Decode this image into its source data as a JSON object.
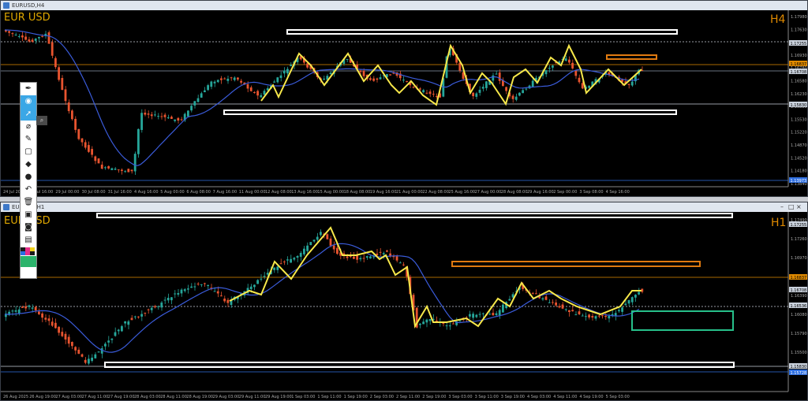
{
  "top": {
    "title": "EURUSD,H4",
    "symbol": "EUR USD",
    "timeframe": "H4",
    "price_labels": [
      "1.17980",
      "1.17630",
      "1.17280",
      "1.16930",
      "1.16780",
      "1.16580",
      "1.16230",
      "1.15880",
      "1.15530",
      "1.15220",
      "1.14870",
      "1.14520",
      "1.14180",
      "1.13840"
    ],
    "highlight_labels": [
      {
        "text": "1.17255",
        "color": "#c9d1dc",
        "fg": "#000"
      },
      {
        "text": "1.16837",
        "color": "#e08a00",
        "fg": "#000"
      },
      {
        "text": "1.16708",
        "color": "#c9d1dc",
        "fg": "#000"
      },
      {
        "text": "1.15830",
        "color": "#c9d1dc",
        "fg": "#000"
      },
      {
        "text": "1.13973",
        "color": "#2f6fe0",
        "fg": "#fff"
      }
    ],
    "time_labels": [
      "24 Jul 2025",
      "25 Jul 16:00",
      "29 Jul 00:00",
      "30 Jul 08:00",
      "31 Jul 16:00",
      "4 Aug 16:00",
      "5 Aug 00:00",
      "6 Aug 08:00",
      "7 Aug 16:00",
      "11 Aug 00:00",
      "12 Aug 08:00",
      "13 Aug 16:00",
      "15 Aug 00:00",
      "18 Aug 08:00",
      "19 Aug 16:00",
      "21 Aug 00:00",
      "22 Aug 08:00",
      "25 Aug 16:00",
      "27 Aug 00:00",
      "28 Aug 08:00",
      "29 Aug 16:00",
      "2 Sep 00:00",
      "3 Sep 08:00",
      "4 Sep 16:00"
    ]
  },
  "bottom": {
    "title": "EURUSD,H1",
    "symbol": "EUR USD",
    "timeframe": "H1",
    "price_labels": [
      "1.17490",
      "1.17260",
      "1.16970",
      "1.16680",
      "1.16390",
      "1.16080",
      "1.15790",
      "1.15500",
      "1.15210"
    ],
    "highlight_labels": [
      {
        "text": "1.17255",
        "color": "#c9d1dc",
        "fg": "#000"
      },
      {
        "text": "1.16837",
        "color": "#e08a00",
        "fg": "#000"
      },
      {
        "text": "1.16708",
        "color": "#c9d1dc",
        "fg": "#000"
      },
      {
        "text": "1.16536",
        "color": "#c9d1dc",
        "fg": "#000"
      },
      {
        "text": "1.15830",
        "color": "#c9d1dc",
        "fg": "#000"
      },
      {
        "text": "1.15728",
        "color": "#2f6fe0",
        "fg": "#fff"
      }
    ],
    "time_labels": [
      "26 Aug 2025",
      "26 Aug 19:00",
      "27 Aug 03:00",
      "27 Aug 11:00",
      "27 Aug 19:00",
      "28 Aug 03:00",
      "28 Aug 11:00",
      "28 Aug 19:00",
      "29 Aug 03:00",
      "29 Aug 11:00",
      "29 Aug 19:00",
      "1 Sep 03:00",
      "1 Sep 11:00",
      "1 Sep 19:00",
      "2 Sep 03:00",
      "2 Sep 11:00",
      "2 Sep 19:00",
      "3 Sep 03:00",
      "3 Sep 11:00",
      "3 Sep 19:00",
      "4 Sep 03:00",
      "4 Sep 11:00",
      "4 Sep 19:00",
      "5 Sep 03:00"
    ]
  },
  "colors": {
    "bull": "#26a69a",
    "bear": "#e8542f",
    "ma": "#3a5bd9",
    "zigzag": "#f7e84a",
    "box_white": "#ffffff",
    "box_orange": "#e07a10",
    "box_green": "#27c08a"
  },
  "toolbar": {
    "tools": [
      "pen-icon",
      "eye-icon",
      "cursor-icon",
      "line-icon",
      "ruler-icon",
      "rectangle-icon",
      "eraser-icon",
      "dot-icon",
      "undo-icon",
      "trash-icon",
      "screenshot-icon",
      "camera-icon",
      "clipboard-icon"
    ]
  }
}
